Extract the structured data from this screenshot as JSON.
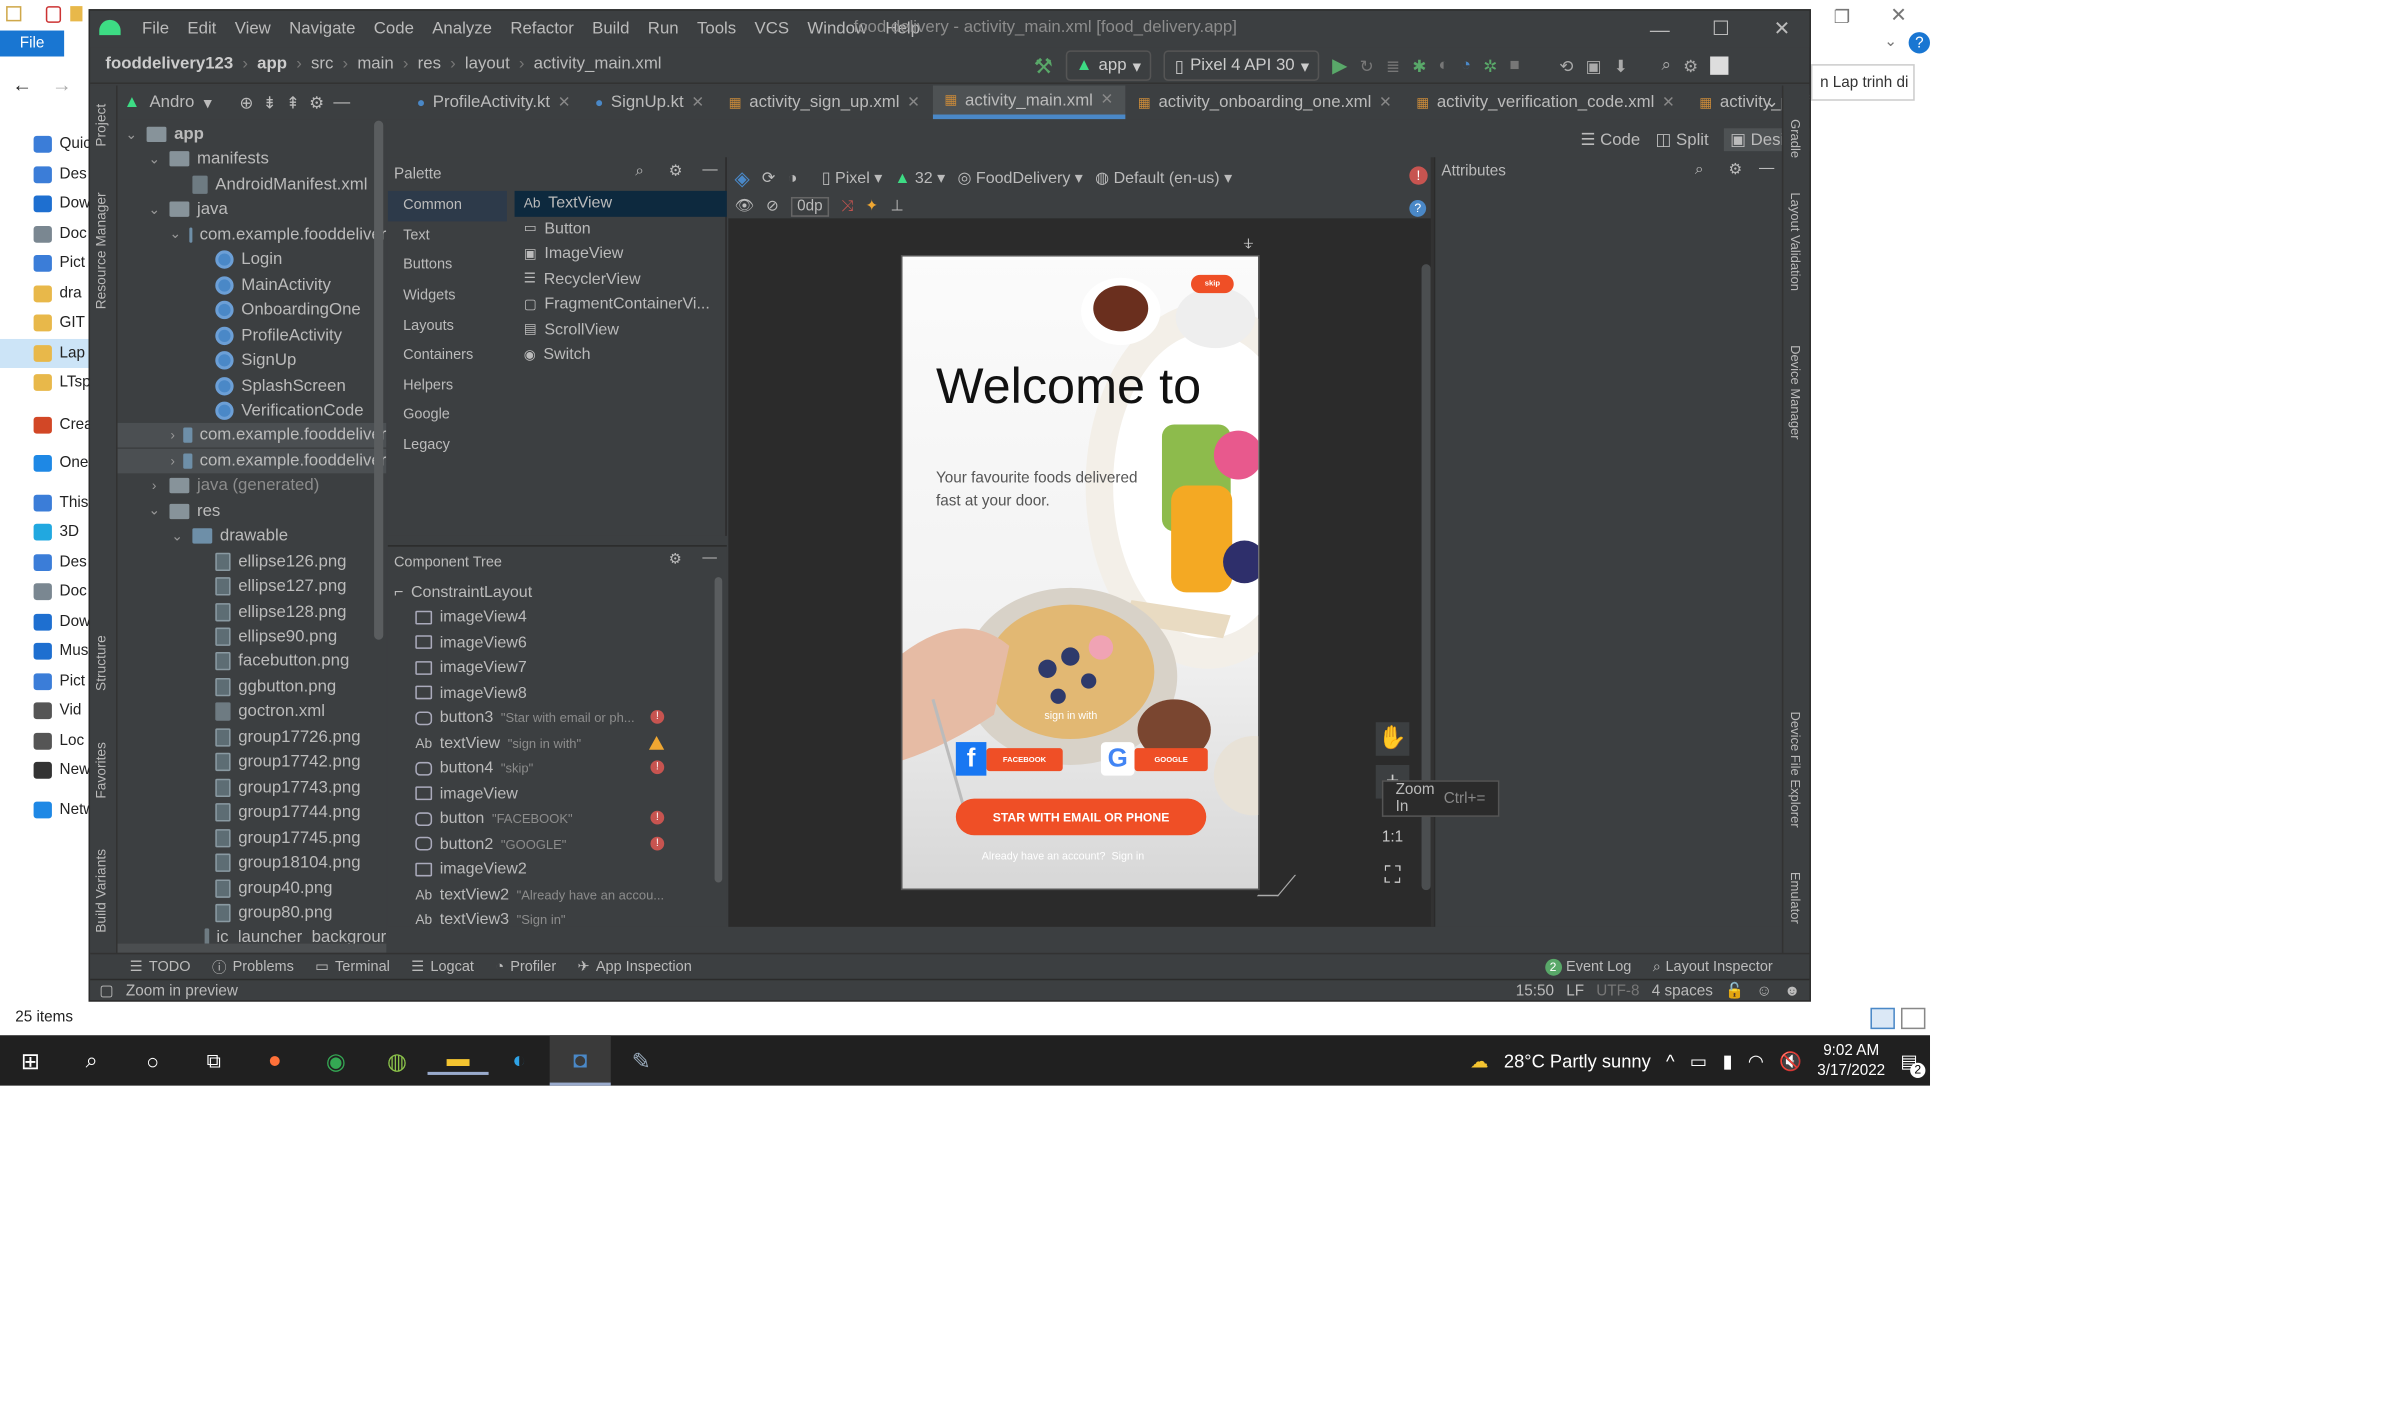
{
  "explorer": {
    "file_button": "File",
    "items": [
      "Quic",
      "Des",
      "Dow",
      "Doc",
      "Pict",
      "dra",
      "GIT",
      "Lap",
      "LTsp",
      "Creat",
      "OneD",
      "This P",
      "3D",
      "Des",
      "Doc",
      "Dow",
      "Mus",
      "Pict",
      "Vid",
      "Loc",
      "New",
      "Netw"
    ],
    "item_count": "25 items",
    "right_fragment": "n Lap trinh di ..."
  },
  "ide": {
    "menu": [
      "File",
      "Edit",
      "View",
      "Navigate",
      "Code",
      "Analyze",
      "Refactor",
      "Build",
      "Run",
      "Tools",
      "VCS",
      "Window",
      "Help"
    ],
    "window_title": "food delivery - activity_main.xml [food_delivery.app]",
    "breadcrumb": [
      "fooddelivery123",
      "app",
      "src",
      "main",
      "res",
      "layout",
      "activity_main.xml"
    ],
    "run_config": "app",
    "device": "Pixel 4 API 30",
    "project_view": "Andro",
    "editor_tabs": [
      {
        "label": "ProfileActivity.kt",
        "active": false
      },
      {
        "label": "SignUp.kt",
        "active": false
      },
      {
        "label": "activity_sign_up.xml",
        "active": false
      },
      {
        "label": "activity_main.xml",
        "active": true
      },
      {
        "label": "activity_onboarding_one.xml",
        "active": false
      },
      {
        "label": "activity_verification_code.xml",
        "active": false
      },
      {
        "label": "activity_profile.xml",
        "active": false
      }
    ],
    "left_strip": [
      "Project",
      "Resource Manager",
      "Structure",
      "Favorites",
      "Build Variants"
    ],
    "right_strip": [
      "Gradle",
      "Layout Validation",
      "Device Manager",
      "Device File Explorer",
      "Emulator"
    ],
    "view_modes": {
      "code": "Code",
      "split": "Split",
      "design": "Design"
    }
  },
  "tree": [
    {
      "label": "app",
      "depth": 0,
      "kind": "folder",
      "open": true,
      "bold": true
    },
    {
      "label": "manifests",
      "depth": 1,
      "kind": "folder",
      "open": true
    },
    {
      "label": "AndroidManifest.xml",
      "depth": 2,
      "kind": "xml"
    },
    {
      "label": "java",
      "depth": 1,
      "kind": "folder",
      "open": true
    },
    {
      "label": "com.example.fooddeliver",
      "depth": 2,
      "kind": "folder",
      "open": true
    },
    {
      "label": "Login",
      "depth": 3,
      "kind": "kt"
    },
    {
      "label": "MainActivity",
      "depth": 3,
      "kind": "kt"
    },
    {
      "label": "OnboardingOne",
      "depth": 3,
      "kind": "kt"
    },
    {
      "label": "ProfileActivity",
      "depth": 3,
      "kind": "kt"
    },
    {
      "label": "SignUp",
      "depth": 3,
      "kind": "kt"
    },
    {
      "label": "SplashScreen",
      "depth": 3,
      "kind": "kt"
    },
    {
      "label": "VerificationCode",
      "depth": 3,
      "kind": "kt"
    },
    {
      "label": "com.example.fooddeliver",
      "depth": 2,
      "kind": "folder",
      "open": false,
      "sel": true
    },
    {
      "label": "com.example.fooddeliver",
      "depth": 2,
      "kind": "folder",
      "open": false,
      "sel": true
    },
    {
      "label": "java (generated)",
      "depth": 1,
      "kind": "folder",
      "open": false,
      "gen": true
    },
    {
      "label": "res",
      "depth": 1,
      "kind": "folder",
      "open": true
    },
    {
      "label": "drawable",
      "depth": 2,
      "kind": "folder",
      "open": true
    },
    {
      "label": "ellipse126.png",
      "depth": 3,
      "kind": "png"
    },
    {
      "label": "ellipse127.png",
      "depth": 3,
      "kind": "png"
    },
    {
      "label": "ellipse128.png",
      "depth": 3,
      "kind": "png"
    },
    {
      "label": "ellipse90.png",
      "depth": 3,
      "kind": "png"
    },
    {
      "label": "facebutton.png",
      "depth": 3,
      "kind": "png"
    },
    {
      "label": "ggbutton.png",
      "depth": 3,
      "kind": "png"
    },
    {
      "label": "goctron.xml",
      "depth": 3,
      "kind": "xml"
    },
    {
      "label": "group17726.png",
      "depth": 3,
      "kind": "png"
    },
    {
      "label": "group17742.png",
      "depth": 3,
      "kind": "png"
    },
    {
      "label": "group17743.png",
      "depth": 3,
      "kind": "png"
    },
    {
      "label": "group17744.png",
      "depth": 3,
      "kind": "png"
    },
    {
      "label": "group17745.png",
      "depth": 3,
      "kind": "png"
    },
    {
      "label": "group18104.png",
      "depth": 3,
      "kind": "png"
    },
    {
      "label": "group40.png",
      "depth": 3,
      "kind": "png"
    },
    {
      "label": "group80.png",
      "depth": 3,
      "kind": "png"
    },
    {
      "label": "ic_launcher_backgrour",
      "depth": 3,
      "kind": "xml"
    }
  ],
  "palette": {
    "title": "Palette",
    "categories": [
      "Common",
      "Text",
      "Buttons",
      "Widgets",
      "Layouts",
      "Containers",
      "Helpers",
      "Google",
      "Legacy"
    ],
    "items": [
      "TextView",
      "Button",
      "ImageView",
      "RecyclerView",
      "FragmentContainerVi...",
      "ScrollView",
      "Switch"
    ]
  },
  "component_tree": {
    "title": "Component Tree",
    "root": "ConstraintLayout",
    "nodes": [
      {
        "name": "imageView4",
        "hint": "",
        "kind": "image",
        "status": ""
      },
      {
        "name": "imageView6",
        "hint": "",
        "kind": "image",
        "status": ""
      },
      {
        "name": "imageView7",
        "hint": "",
        "kind": "image",
        "status": ""
      },
      {
        "name": "imageView8",
        "hint": "",
        "kind": "image",
        "status": ""
      },
      {
        "name": "button3",
        "hint": "\"Star with email or ph...",
        "kind": "button",
        "status": "error"
      },
      {
        "name": "textView",
        "hint": "\"sign in with\"",
        "kind": "text",
        "status": "warning"
      },
      {
        "name": "button4",
        "hint": "\"skip\"",
        "kind": "button",
        "status": "error"
      },
      {
        "name": "imageView",
        "hint": "",
        "kind": "image",
        "status": ""
      },
      {
        "name": "button",
        "hint": "\"FACEBOOK\"",
        "kind": "button",
        "status": "error"
      },
      {
        "name": "button2",
        "hint": "\"GOOGLE\"",
        "kind": "button",
        "status": "error"
      },
      {
        "name": "imageView2",
        "hint": "",
        "kind": "image",
        "status": ""
      },
      {
        "name": "textView2",
        "hint": "\"Already have an accou...",
        "kind": "text",
        "status": ""
      },
      {
        "name": "textView3",
        "hint": "\"Sign in\"",
        "kind": "text",
        "status": ""
      }
    ]
  },
  "design_toolbar": {
    "pixel": "Pixel",
    "api": "32",
    "theme": "FoodDelivery",
    "locale": "Default (en-us)",
    "margin": "0dp"
  },
  "attributes": {
    "title": "Attributes"
  },
  "zoom_tooltip": {
    "label": "Zoom In",
    "shortcut": "Ctrl+="
  },
  "zoom_ratio": "1:1",
  "phone": {
    "skip": "skip",
    "welcome": "Welcome to",
    "subtitle": "Your favourite foods delivered fast at your door.",
    "sign_in_with": "sign in with",
    "facebook": "FACEBOOK",
    "google": "GOOGLE",
    "email_button": "STAR WITH EMAIL OR PHONE",
    "already": "Already have an account?",
    "sign_in": "Sign in",
    "accent": "#ef4f26"
  },
  "bottom_tools": [
    "TODO",
    "Problems",
    "Terminal",
    "Logcat",
    "Profiler",
    "App Inspection"
  ],
  "bottom_right": {
    "event_log": "Event Log",
    "event_count": "2",
    "layout_inspector": "Layout Inspector"
  },
  "status": {
    "message": "Zoom in preview",
    "position": "15:50",
    "line_sep": "LF",
    "encoding": "UTF-8",
    "indent": "4 spaces"
  },
  "taskbar": {
    "weather": "28°C  Partly sunny",
    "time": "9:02 AM",
    "date": "3/17/2022",
    "notif": "2"
  }
}
